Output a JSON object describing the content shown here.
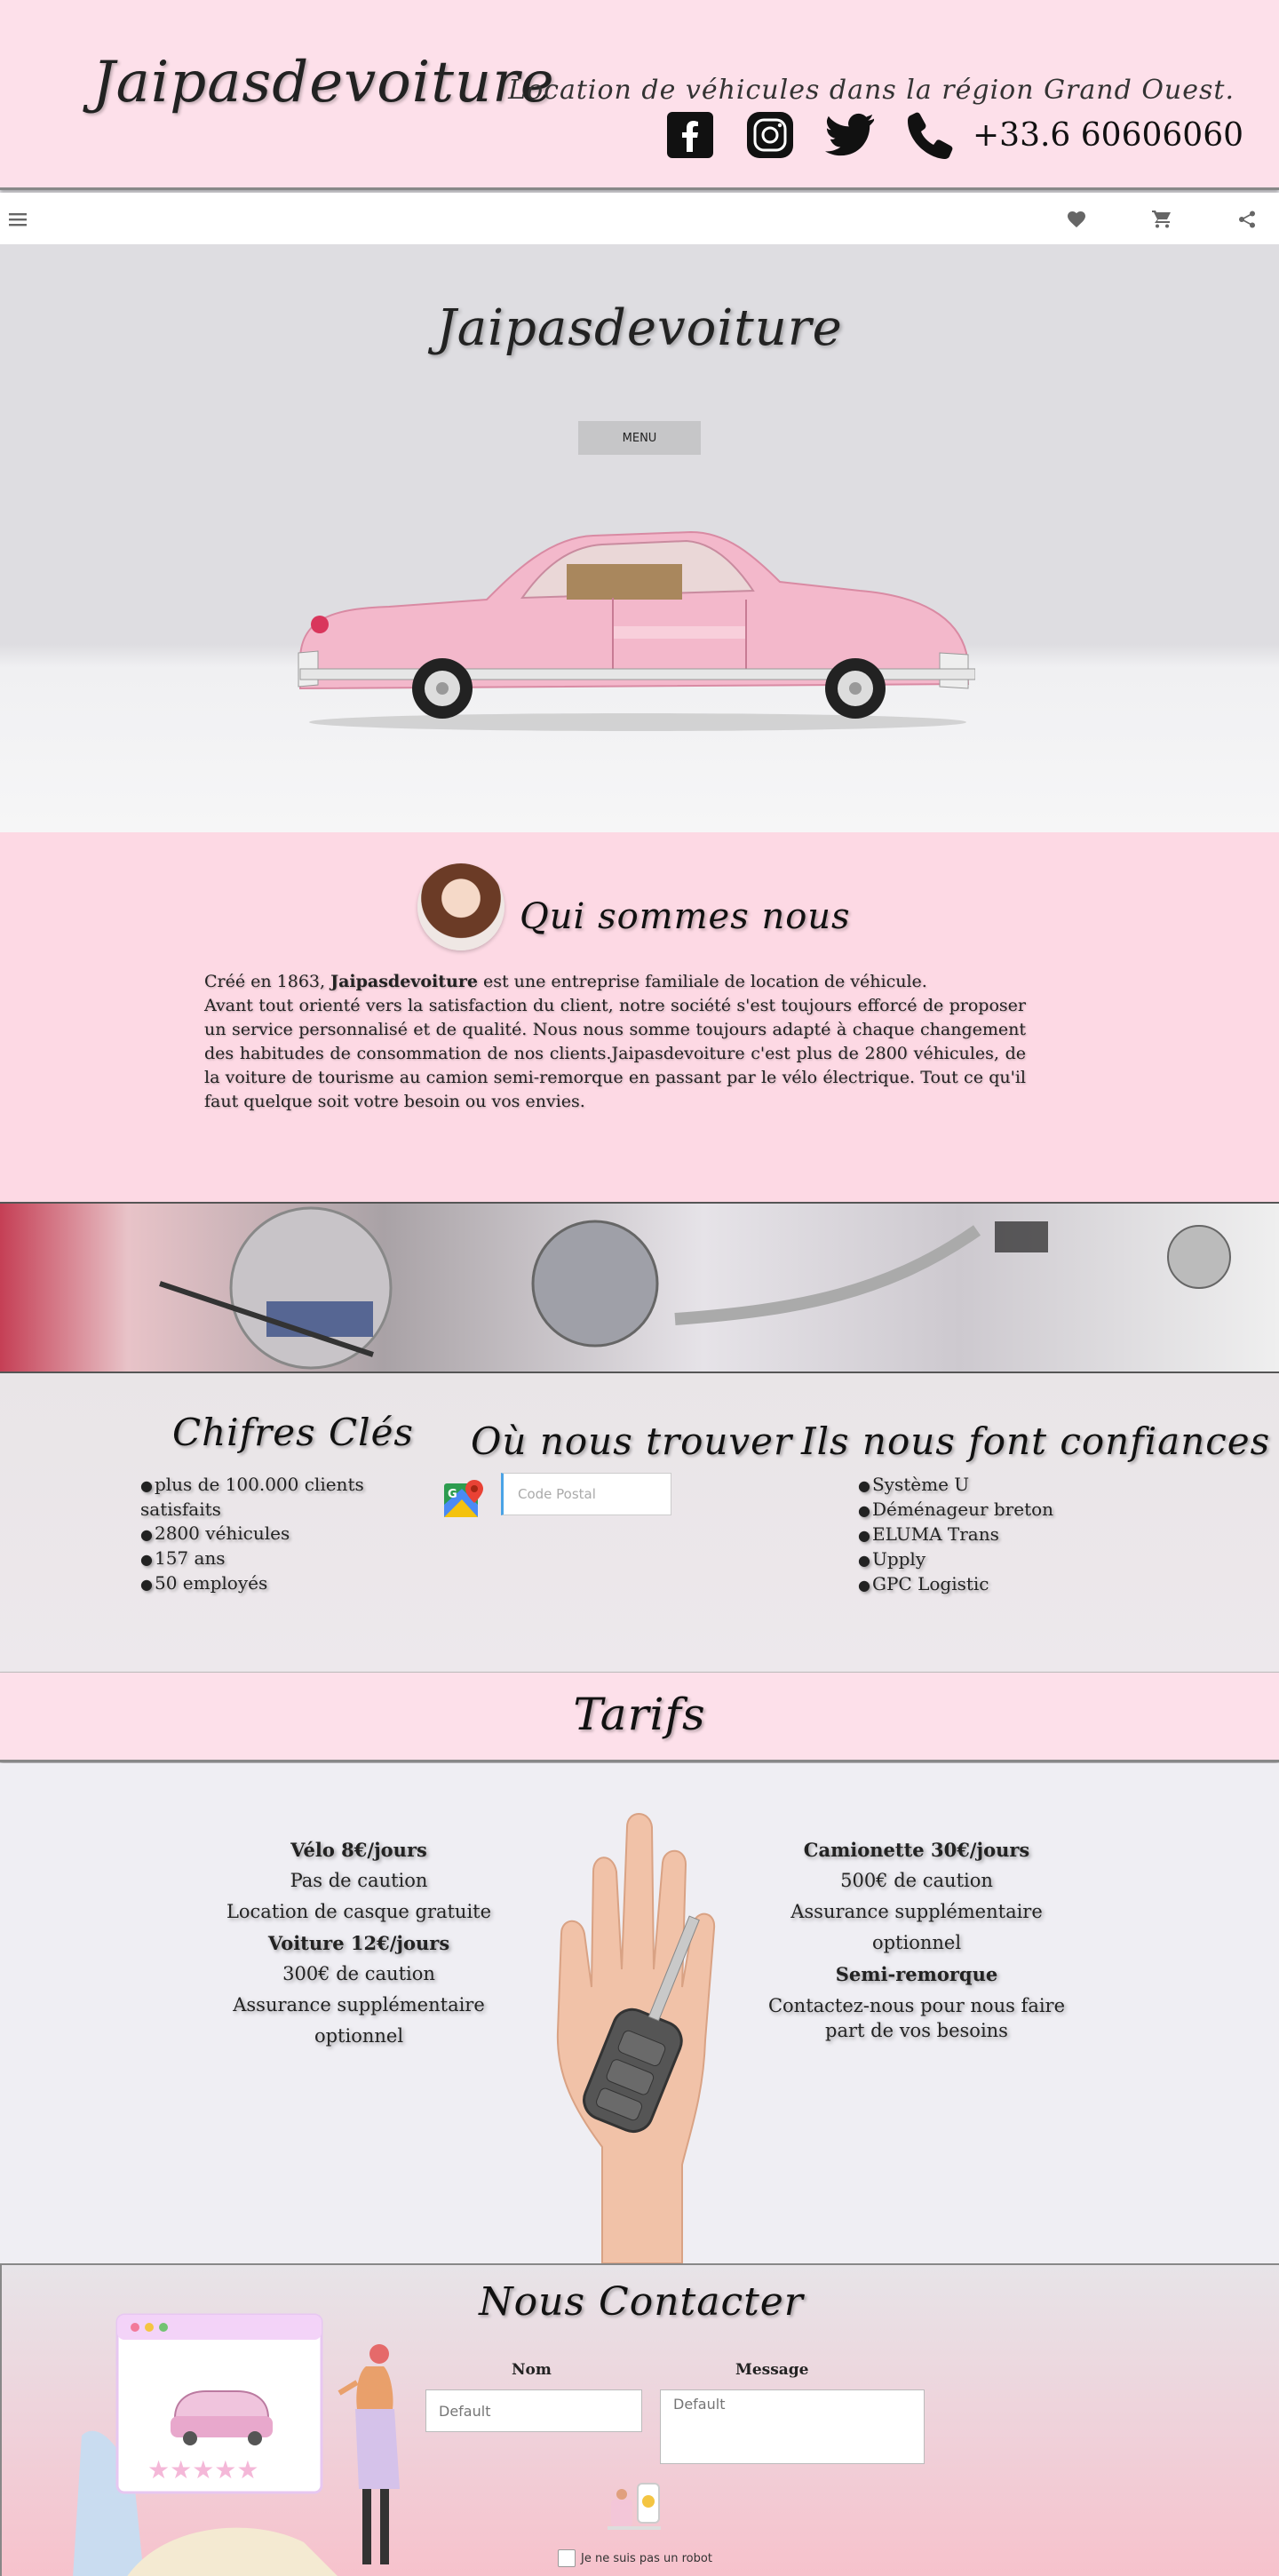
{
  "header": {
    "logo": "Jaipasdevoiture",
    "tagline": "Location de véhicules dans la région Grand Ouest.",
    "phone": "+33.6 60606060",
    "social_icons": [
      "facebook-icon",
      "instagram-icon",
      "twitter-icon",
      "phone-icon"
    ]
  },
  "toolbar": {
    "icons": [
      "hamburger-icon",
      "heart-icon",
      "cart-icon",
      "share-icon"
    ]
  },
  "hero": {
    "title": "Jaipasdevoiture",
    "menu_label": "MENU"
  },
  "about": {
    "title": "Qui sommes nous",
    "intro_prefix": "Créé en 1863, ",
    "brand": "Jaipasdevoiture",
    "intro_suffix": " est une entreprise familiale de location de véhicule.",
    "body": "Avant tout orienté vers la satisfaction du client, notre société s'est toujours efforcé de proposer un service personnalisé et de qualité. Nous nous somme toujours adapté à chaque changement des habitudes de consommation de nos clients.Jaipasdevoiture c'est plus de 2800 véhicules, de la voiture de tourisme au camion semi-remorque en passant par le vélo électrique. Tout ce qu'il faut quelque soit votre besoin ou vos envies."
  },
  "key_figures": {
    "title": "Chifres Clés",
    "items": [
      "plus de 100.000 clients satisfaits",
      "2800 véhicules",
      "157 ans",
      "50 employés"
    ]
  },
  "find_us": {
    "title": "Où nous trouver",
    "postal_placeholder": "Code Postal"
  },
  "partners": {
    "title": "Ils nous font confiances",
    "items": [
      "Système U",
      "Déménageur breton",
      "ELUMA Trans",
      "Upply",
      "GPC Logistic"
    ]
  },
  "tarifs": {
    "title": "Tarifs",
    "left": [
      {
        "text": "Vélo 8€/jours",
        "heading": true
      },
      {
        "text": "Pas de caution",
        "heading": false
      },
      {
        "text": "Location de casque gratuite",
        "heading": false
      },
      {
        "text": "Voiture 12€/jours",
        "heading": true
      },
      {
        "text": "300€ de caution",
        "heading": false
      },
      {
        "text": "Assurance supplémentaire optionnel",
        "heading": false
      }
    ],
    "right": [
      {
        "text": "Camionette 30€/jours",
        "heading": true
      },
      {
        "text": "500€ de caution",
        "heading": false
      },
      {
        "text": "Assurance supplémentaire optionnel",
        "heading": false
      },
      {
        "text": "Semi-remorque",
        "heading": true
      },
      {
        "text": "Contactez-nous pour nous faire part de vos besoins",
        "heading": false
      }
    ]
  },
  "contact": {
    "title": "Nous Contacter",
    "name_label": "Nom",
    "name_placeholder": "Default",
    "message_label": "Message",
    "message_placeholder": "Default",
    "captcha_label": "Je ne suis pas un robot",
    "rating_stars": 5
  },
  "colors": {
    "pink": "#fde0ea",
    "about_pink": "#fdd9e4",
    "grey_bg": "#efeef3"
  }
}
